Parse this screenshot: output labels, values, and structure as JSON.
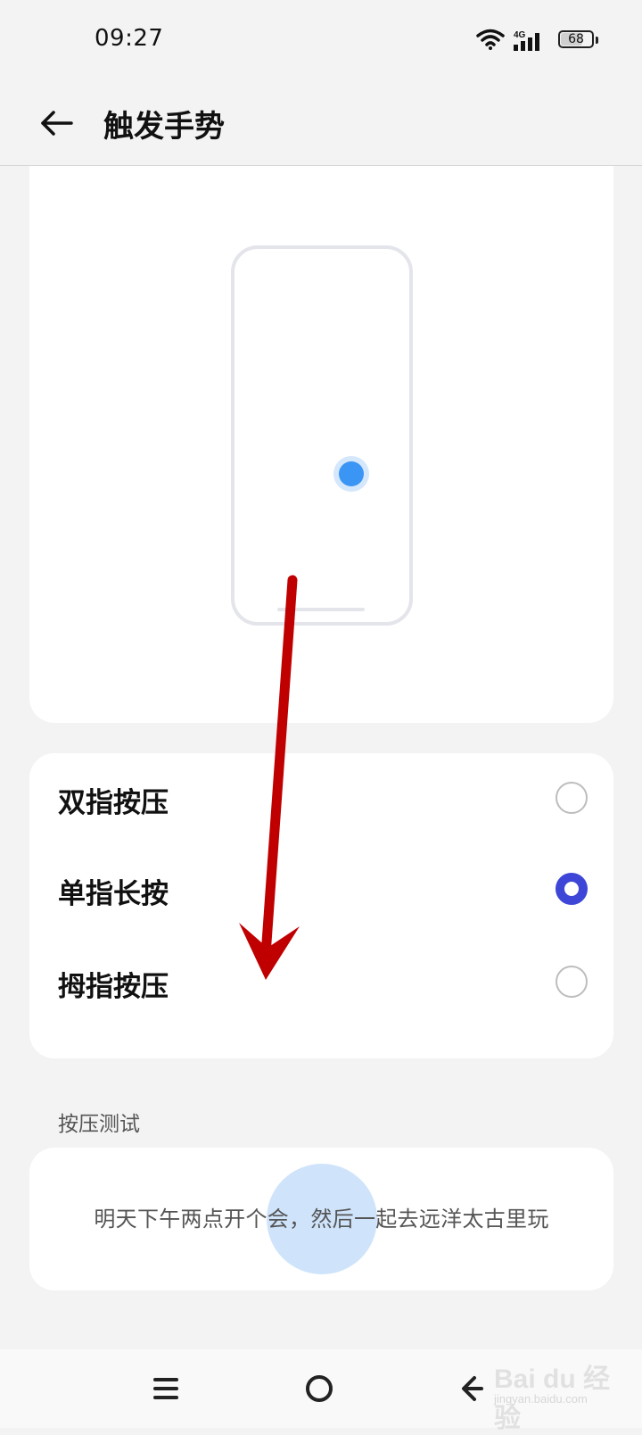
{
  "status_bar": {
    "time": "09:27",
    "network": "4G",
    "battery_level": "68",
    "battery_fraction": 0.68,
    "icons": [
      "wifi-icon",
      "signal-4g-icon",
      "battery-icon"
    ]
  },
  "header": {
    "title": "触发手势",
    "back_icon": "arrow-left-icon"
  },
  "preview": {
    "description_icon": "phone-outline",
    "touch_indicator_color": "#3b95f4"
  },
  "options": [
    {
      "label": "双指按压",
      "selected": false
    },
    {
      "label": "单指长按",
      "selected": true
    },
    {
      "label": "拇指按压",
      "selected": false
    }
  ],
  "test_section": {
    "label": "按压测试",
    "sample_text": "明天下午两点开个会，然后一起去远洋太古里玩"
  },
  "nav_bar": {
    "buttons": [
      "menu-icon",
      "home-icon",
      "back-icon"
    ]
  },
  "watermark": {
    "main": "Bai du 经验",
    "sub": "jingyan.baidu.com"
  },
  "colors": {
    "accent": "#3d46d6",
    "annotation_arrow": "#c00000",
    "press_circle": "#cfe4fb"
  }
}
